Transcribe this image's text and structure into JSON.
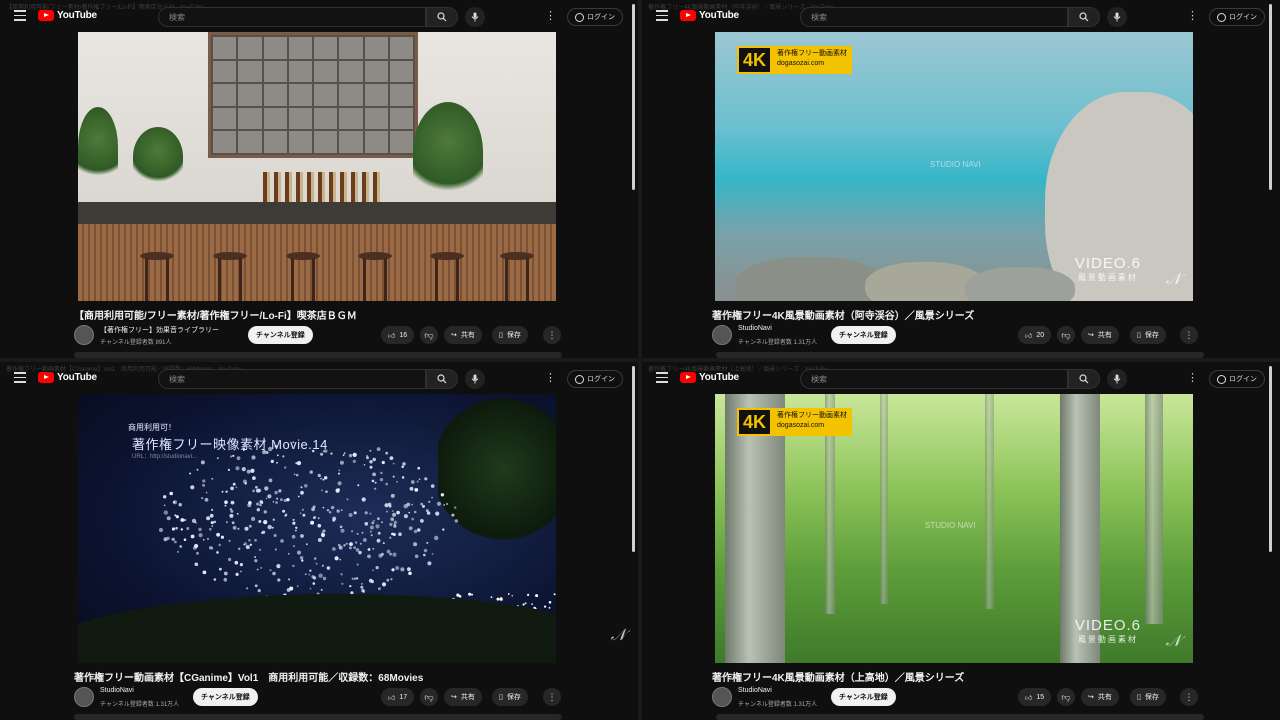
{
  "app": {
    "logo_text": "YouTube",
    "search_placeholder": "検索",
    "login_label": "ログイン",
    "more_label": "⋮",
    "brand_color": "#ff0000"
  },
  "panes": [
    {
      "tab_title": "【商用利用可能/フリー素材/著作権フリー/Lo-Fi】喫茶店ＢＧＭ - YouTube",
      "video_title": "【商用利用可能/フリー素材/著作権フリー/Lo-Fi】喫茶店ＢＧＭ",
      "channel": "【著作権フリー】効果音ライブラリー",
      "subscribers": "チャンネル登録者数 891人",
      "subscribe_label": "チャンネル登録",
      "likes": "16",
      "share_label": "共有",
      "save_label": "保存"
    },
    {
      "tab_title": "著作権フリー4K風景動画素材（阿寺渓谷）／風景シリーズ - YouTube",
      "video_title": "著作権フリー4K風景動画素材（阿寺渓谷）／風景シリーズ",
      "channel": "StudioNavi",
      "subscribers": "チャンネル登録者数 1.31万人",
      "subscribe_label": "チャンネル登録",
      "likes": "20",
      "share_label": "共有",
      "save_label": "保存",
      "overlay": {
        "badge_4k": "4K",
        "badge_line1": "著作権フリー動画素材",
        "badge_line2": "dogasozai.com",
        "watermark": "STUDIO NAVI",
        "video_label": "VIDEO.6",
        "video_sub": "風景動画素材",
        "nv_logo": "𝒩"
      }
    },
    {
      "tab_title": "著作権フリー動画素材【CGanime】Vol1　商用利用可能／収録数：68Movies - YouTube",
      "video_title": "著作権フリー動画素材【CGanime】Vol1　商用利用可能／収録数：68Movies",
      "channel": "StudioNavi",
      "subscribers": "チャンネル登録者数 1.31万人",
      "subscribe_label": "チャンネル登録",
      "likes": "17",
      "share_label": "共有",
      "save_label": "保存",
      "overlay": {
        "line1": "商用利用可！",
        "line2": "著作権フリー映像素材  Movie.14",
        "line3": "URL：http://studionavi...",
        "nv_logo": "𝒩"
      }
    },
    {
      "tab_title": "著作権フリー4K風景動画素材（上高地）／風景シリーズ - YouTube",
      "video_title": "著作権フリー4K風景動画素材（上高地）／風景シリーズ",
      "channel": "StudioNavi",
      "subscribers": "チャンネル登録者数 1.31万人",
      "subscribe_label": "チャンネル登録",
      "likes": "15",
      "share_label": "共有",
      "save_label": "保存",
      "overlay": {
        "badge_4k": "4K",
        "badge_line1": "著作権フリー動画素材",
        "badge_line2": "dogasozai.com",
        "watermark": "STUDIO NAVI",
        "video_label": "VIDEO.6",
        "video_sub": "風景動画素材",
        "nv_logo": "𝒩"
      }
    }
  ]
}
